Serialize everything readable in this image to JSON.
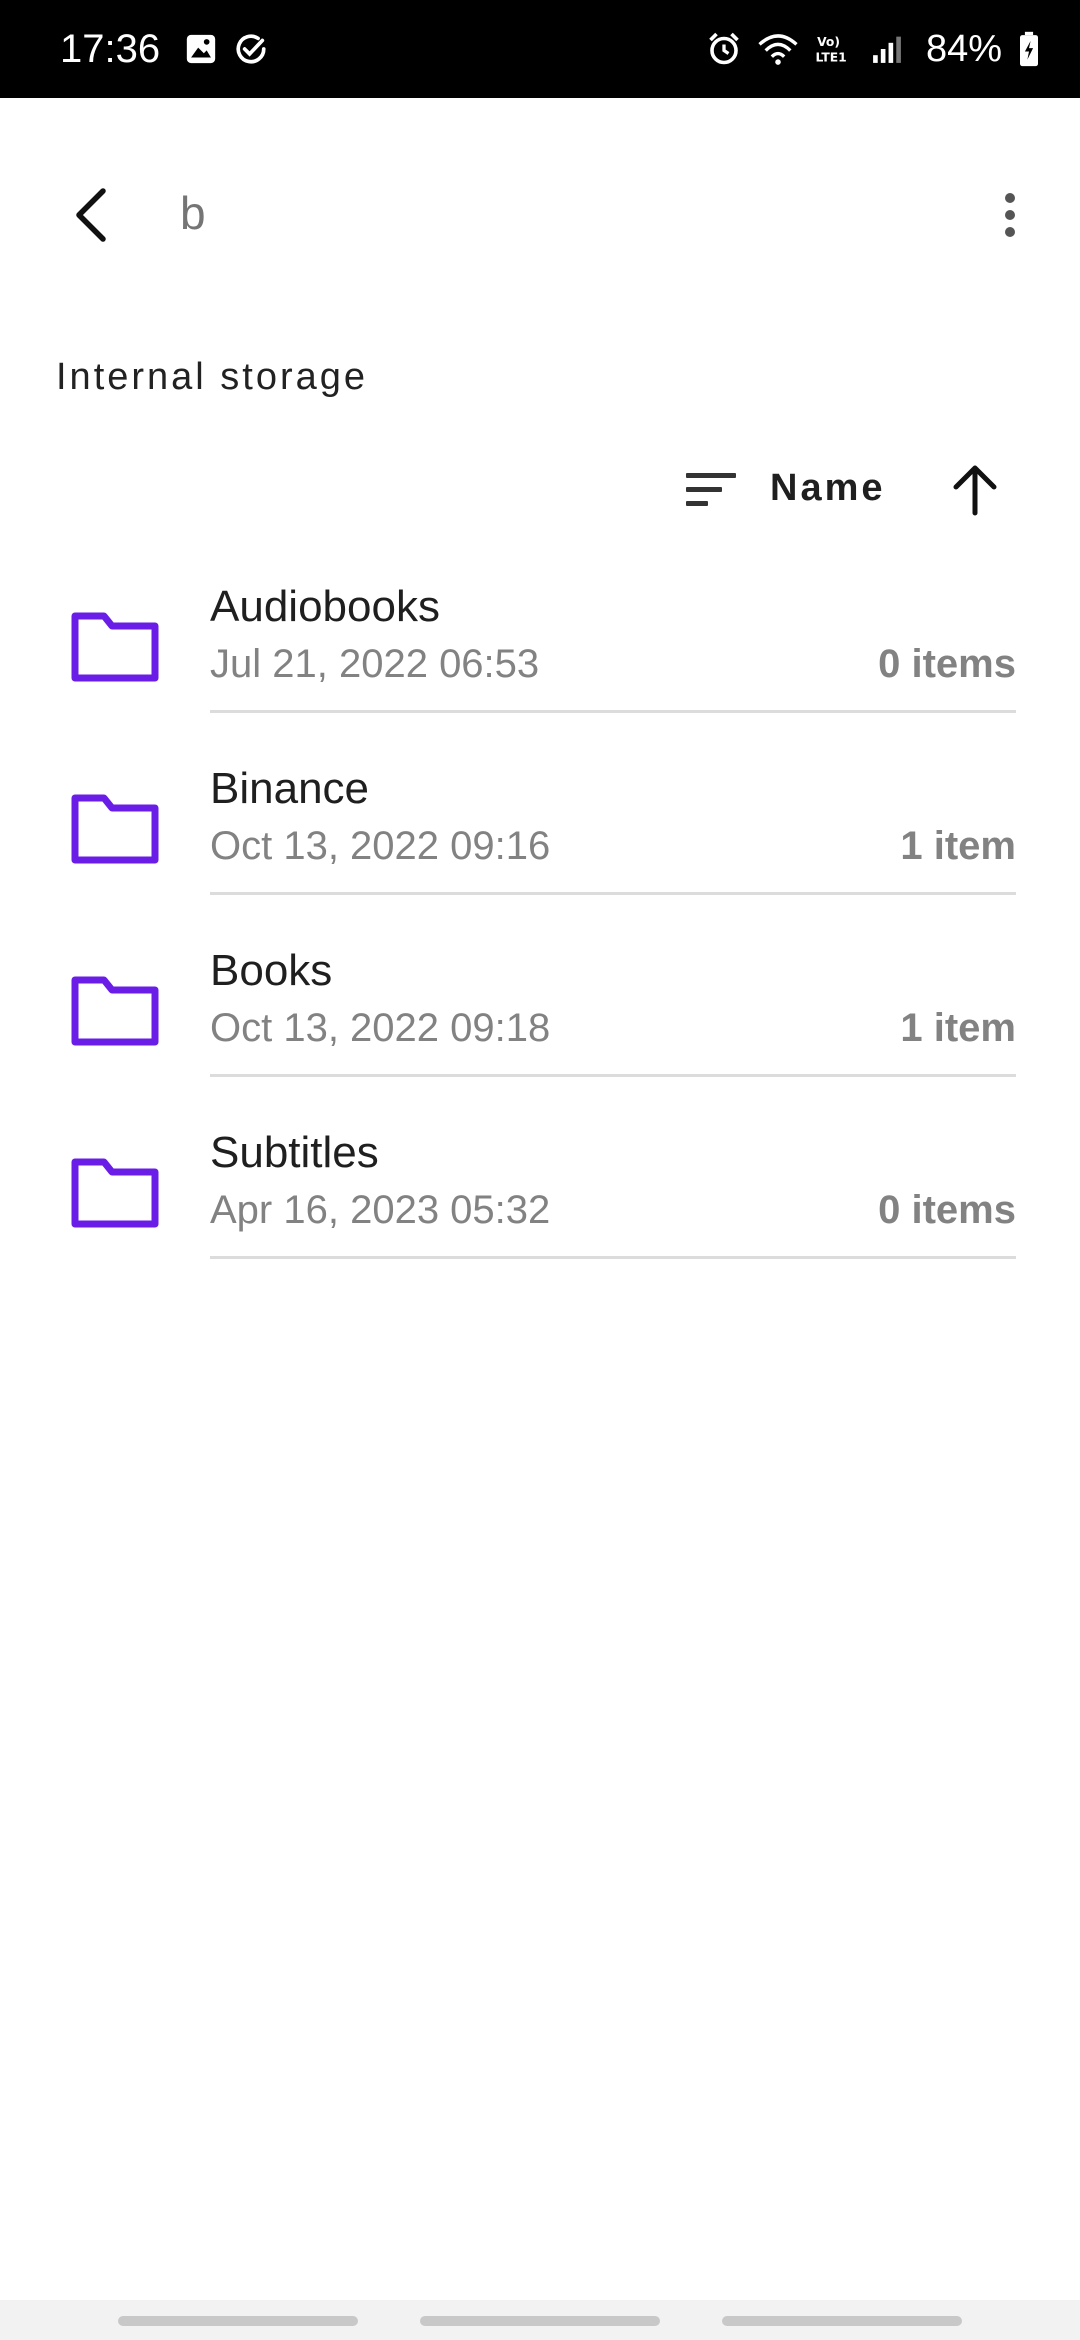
{
  "status_bar": {
    "time": "17:36",
    "battery": "84%",
    "left_icons": [
      "gallery-icon",
      "check-circle-icon"
    ],
    "right_icons": [
      "alarm-icon",
      "wifi-icon",
      "volte-icon",
      "signal-icon",
      "battery-charging-icon"
    ]
  },
  "app_bar": {
    "search_query": "b",
    "back_icon": "back-arrow-icon",
    "menu_icon": "more-vert-icon"
  },
  "location": "Internal storage",
  "sort": {
    "label": "Name",
    "direction": "ascending"
  },
  "files": [
    {
      "name": "Audiobooks",
      "date": "Jul 21, 2022 06:53",
      "count": "0 items"
    },
    {
      "name": "Binance",
      "date": "Oct 13, 2022 09:16",
      "count": "1 item"
    },
    {
      "name": "Books",
      "date": "Oct 13, 2022 09:18",
      "count": "1 item"
    },
    {
      "name": "Subtitles",
      "date": "Apr 16, 2023 05:32",
      "count": "0 items"
    }
  ],
  "colors": {
    "accent": "#6a1de6",
    "status_bar": "#000000"
  }
}
